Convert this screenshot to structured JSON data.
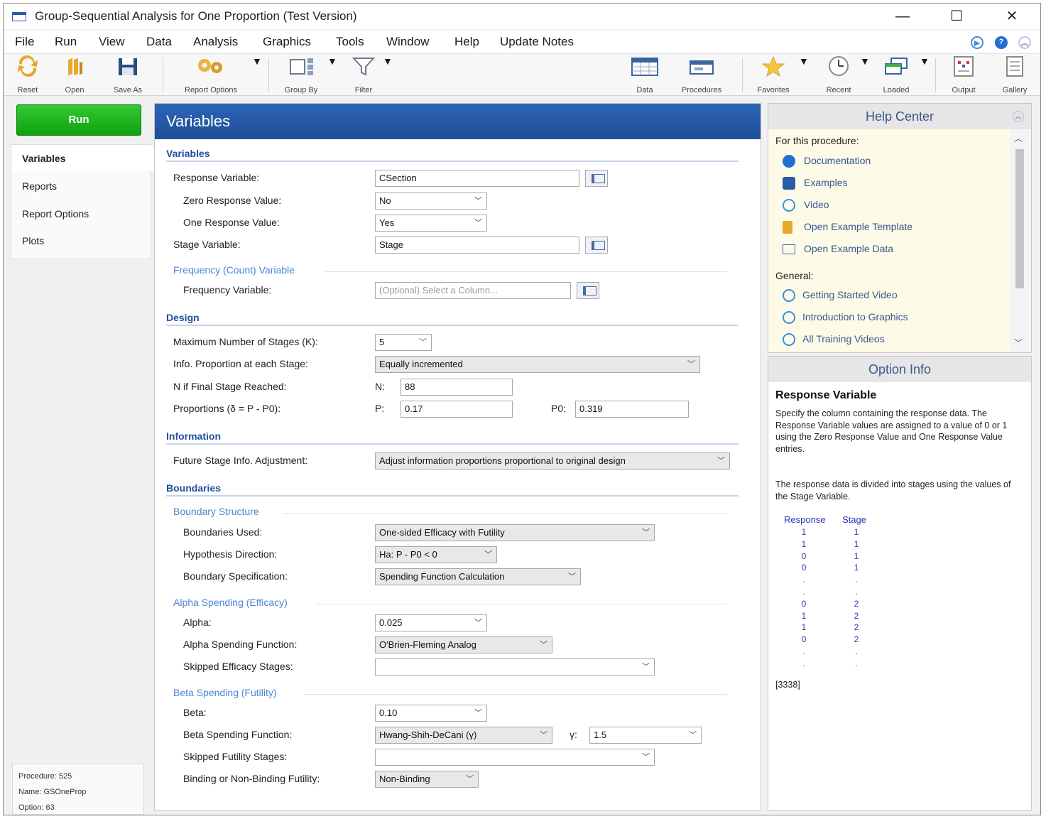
{
  "window": {
    "title": "Group-Sequential Analysis for One Proportion (Test Version)",
    "minimize": "—",
    "maximize": "☐",
    "close": "✕"
  },
  "menu": [
    "File",
    "Run",
    "View",
    "Data",
    "Analysis",
    "Graphics",
    "Tools",
    "Window",
    "Help",
    "Update Notes"
  ],
  "toolbar": {
    "reset": "Reset",
    "open": "Open",
    "save_as": "Save As",
    "report_options": "Report Options",
    "group_by": "Group By",
    "filter": "Filter",
    "data": "Data",
    "procedures": "Procedures",
    "favorites": "Favorites",
    "recent": "Recent",
    "loaded": "Loaded",
    "output": "Output",
    "gallery": "Gallery"
  },
  "nav": {
    "run": "Run",
    "items": [
      "Variables",
      "Reports",
      "Report Options",
      "Plots"
    ]
  },
  "procinfo": {
    "procedure": "Procedure: 525",
    "name": "Name: GSOneProp",
    "option": "Option: 63"
  },
  "main": {
    "header": "Variables",
    "variables": {
      "title": "Variables",
      "response_label": "Response Variable:",
      "response_value": "CSection",
      "zero_label": "Zero Response Value:",
      "zero_value": "No",
      "one_label": "One Response Value:",
      "one_value": "Yes",
      "stage_label": "Stage Variable:",
      "stage_value": "Stage",
      "freq_sub": "Frequency (Count) Variable",
      "freq_label": "Frequency Variable:",
      "freq_placeholder": "(Optional) Select a Column..."
    },
    "design": {
      "title": "Design",
      "k_label": "Maximum Number of Stages (K):",
      "k_value": "5",
      "info_label": "Info. Proportion at each Stage:",
      "info_value": "Equally incremented",
      "n_label": "N if Final Stage Reached:",
      "n_prefix": "N:",
      "n_value": "88",
      "prop_label": "Proportions (δ = P - P0):",
      "p_prefix": "P:",
      "p_value": "0.17",
      "p0_prefix": "P0:",
      "p0_value": "0.319"
    },
    "information": {
      "title": "Information",
      "future_label": "Future Stage Info. Adjustment:",
      "future_value": "Adjust information proportions proportional to original design"
    },
    "boundaries": {
      "title": "Boundaries",
      "structure_sub": "Boundary Structure",
      "used_label": "Boundaries Used:",
      "used_value": "One-sided Efficacy with Futility",
      "dir_label": "Hypothesis Direction:",
      "dir_value": "Ha: P - P0 < 0",
      "spec_label": "Boundary Specification:",
      "spec_value": "Spending Function Calculation",
      "alpha_sub": "Alpha Spending (Efficacy)",
      "alpha_label": "Alpha:",
      "alpha_value": "0.025",
      "alpha_fn_label": "Alpha Spending Function:",
      "alpha_fn_value": "O'Brien-Fleming Analog",
      "skip_eff_label": "Skipped Efficacy Stages:",
      "skip_eff_value": "",
      "beta_sub": "Beta Spending (Futility)",
      "beta_label": "Beta:",
      "beta_value": "0.10",
      "beta_fn_label": "Beta Spending Function:",
      "beta_fn_value": "Hwang-Shih-DeCani (γ)",
      "gamma_prefix": "γ:",
      "gamma_value": "1.5",
      "skip_fut_label": "Skipped Futility Stages:",
      "skip_fut_value": "",
      "binding_label": "Binding or Non-Binding Futility:",
      "binding_value": "Non-Binding"
    }
  },
  "help": {
    "title": "Help Center",
    "for_proc": "For this procedure:",
    "links1": [
      "Documentation",
      "Examples",
      "Video",
      "Open Example Template",
      "Open Example Data"
    ],
    "general": "General:",
    "links2": [
      "Getting Started Video",
      "Introduction to Graphics",
      "All Training Videos"
    ]
  },
  "option_info": {
    "title": "Option Info",
    "heading": "Response Variable",
    "p1": "Specify the column containing the response data. The Response Variable values are assigned to a value of 0 or 1 using the Zero Response Value and One Response Value entries.",
    "p2": "The response data is divided into stages using the values of the Stage Variable.",
    "col_response": "Response",
    "col_stage": "Stage",
    "response": [
      "1",
      "1",
      "0",
      "0",
      ".",
      ".",
      "0",
      "1",
      "1",
      "0",
      ".",
      "."
    ],
    "stage": [
      "1",
      "1",
      "1",
      "1",
      ".",
      ".",
      "2",
      "2",
      "2",
      "2",
      ".",
      "."
    ],
    "id": "[3338]"
  }
}
